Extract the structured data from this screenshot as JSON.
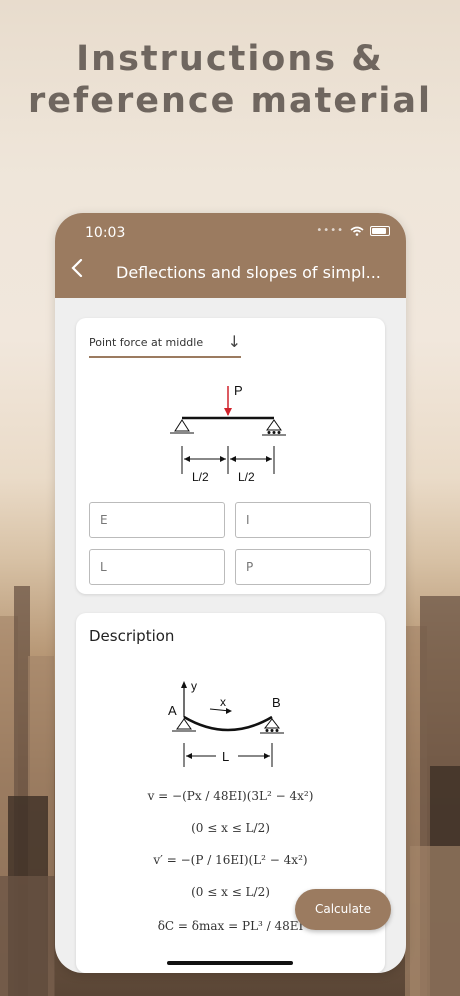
{
  "headline": "Instructions & reference material",
  "status": {
    "time": "10:03"
  },
  "nav": {
    "back_icon": "chevron-left-icon",
    "title": "Deflections and slopes of simpl..."
  },
  "form": {
    "selected_case": "Point force at middle",
    "diagram_labels": {
      "load": "P",
      "left_span": "L/2",
      "right_span": "L/2"
    },
    "fields": [
      {
        "placeholder": "E"
      },
      {
        "placeholder": "I"
      },
      {
        "placeholder": "L"
      },
      {
        "placeholder": "P"
      }
    ]
  },
  "description": {
    "title": "Description",
    "diagram_labels": {
      "y_axis": "y",
      "x_axis": "x",
      "support_a": "A",
      "support_b": "B",
      "span": "L"
    },
    "formulas": [
      "v = −(Px / 48EI)(3L² − 4x²)",
      "(0 ≤ x ≤ L/2)",
      "v′ = −(P / 16EI)(L² − 4x²)",
      "(0 ≤ x ≤ L/2)",
      "δC = δmax = PL³ / 48EI"
    ]
  },
  "actions": {
    "calculate_label": "Calculate"
  },
  "colors": {
    "accent": "#9b7b60",
    "headline": "#6f665f",
    "load_arrow": "#d0232c"
  }
}
